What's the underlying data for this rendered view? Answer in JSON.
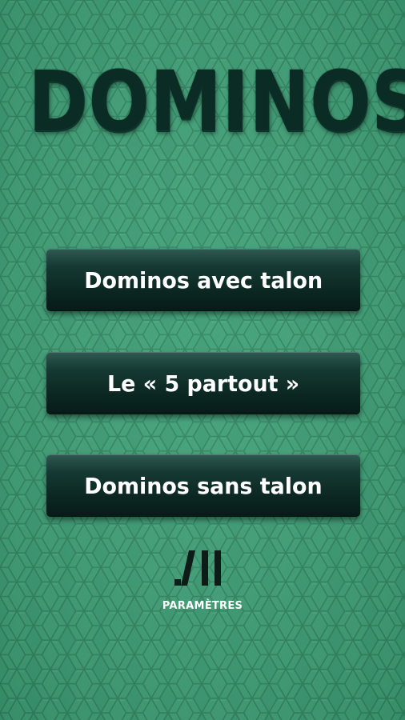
{
  "app": {
    "title": "DOMINOS"
  },
  "menu": {
    "buttons": [
      {
        "label": "Dominos avec talon"
      },
      {
        "label": "Le « 5 partout »"
      },
      {
        "label": "Dominos sans talon"
      }
    ]
  },
  "settings": {
    "label": "PARAMÈTRES",
    "icon": "settings-bars-icon"
  },
  "colors": {
    "background": "#3a9a72",
    "hex_outline": "#2e7f5c",
    "title": "#0b2c24",
    "button_dark": "#0b2621",
    "button_text": "#ffffff"
  }
}
